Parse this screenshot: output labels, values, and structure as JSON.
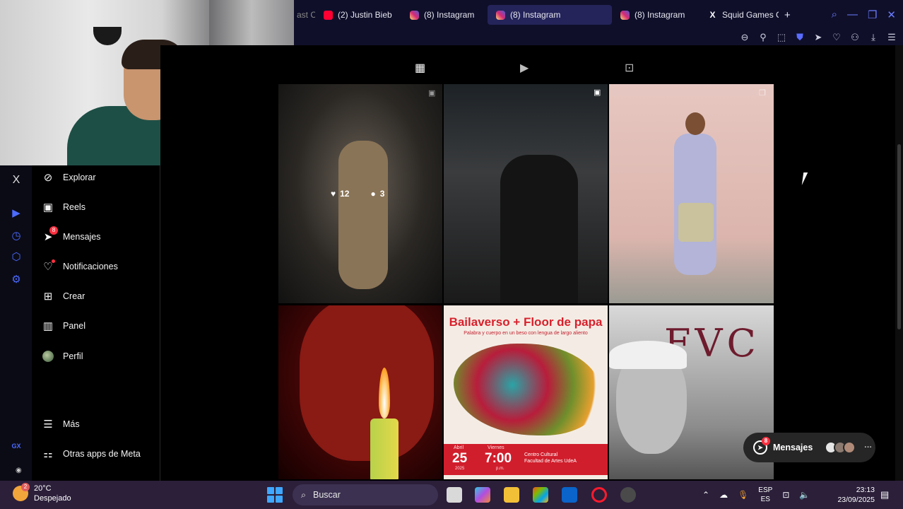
{
  "browser": {
    "tabs": [
      {
        "label": "(2) Justin Bieb",
        "favicon": "youtube-icon",
        "active": false
      },
      {
        "label": "(8) Instagram",
        "favicon": "instagram-icon",
        "active": false
      },
      {
        "label": "(8) Instagram",
        "favicon": "instagram-icon",
        "active": true
      },
      {
        "label": "(8) Instagram",
        "favicon": "instagram-icon",
        "active": false
      },
      {
        "label": "Squid Games C",
        "favicon": "x-icon",
        "active": false
      }
    ],
    "partial_tab": "ast C",
    "new_tab_symbol": "+",
    "accent_color": "#5a6cff"
  },
  "sidebar": {
    "close_symbol": "X",
    "items": [
      {
        "label": "Explorar",
        "icon": "compass-icon"
      },
      {
        "label": "Reels",
        "icon": "reels-icon"
      },
      {
        "label": "Mensajes",
        "icon": "messenger-icon",
        "badge": "8"
      },
      {
        "label": "Notificaciones",
        "icon": "heart-icon"
      },
      {
        "label": "Crear",
        "icon": "plus-square-icon"
      },
      {
        "label": "Panel",
        "icon": "chart-icon"
      },
      {
        "label": "Perfil",
        "icon": "profile-avatar"
      }
    ],
    "bottom_items": [
      {
        "label": "Más",
        "icon": "menu-icon"
      },
      {
        "label": "Otras apps de Meta",
        "icon": "apps-icon"
      }
    ],
    "gx_label": "GX"
  },
  "profile_tabs": [
    {
      "name": "posts",
      "icon": "grid-icon",
      "active": true
    },
    {
      "name": "reels",
      "icon": "reels-icon",
      "active": false
    },
    {
      "name": "tagged",
      "icon": "tagged-icon",
      "active": false
    }
  ],
  "posts": [
    {
      "likes": "12",
      "comments": "3"
    },
    {},
    {},
    {},
    {
      "title": "Bailaverso + Floor de papa",
      "subtitle": "Palabra y cuerpo en un beso con lengua de largo aliento",
      "month": "Abril",
      "day": "25",
      "year": "2025",
      "weekday": "Viernes",
      "time": "7:00",
      "time_suffix": "p.m.",
      "venue_line1": "Centro Cultural",
      "venue_line2": "Facultad de Artes UdeA"
    },
    {
      "graffiti": "FVC"
    }
  ],
  "messages_pill": {
    "label": "Mensajes",
    "badge": "8",
    "more": "···"
  },
  "taskbar": {
    "weather_temp": "20°C",
    "weather_desc": "Despejado",
    "weather_badge": "2",
    "search_placeholder": "Buscar",
    "lang_top": "ESP",
    "lang_bottom": "ES",
    "time": "23:13",
    "date": "23/09/2025"
  }
}
